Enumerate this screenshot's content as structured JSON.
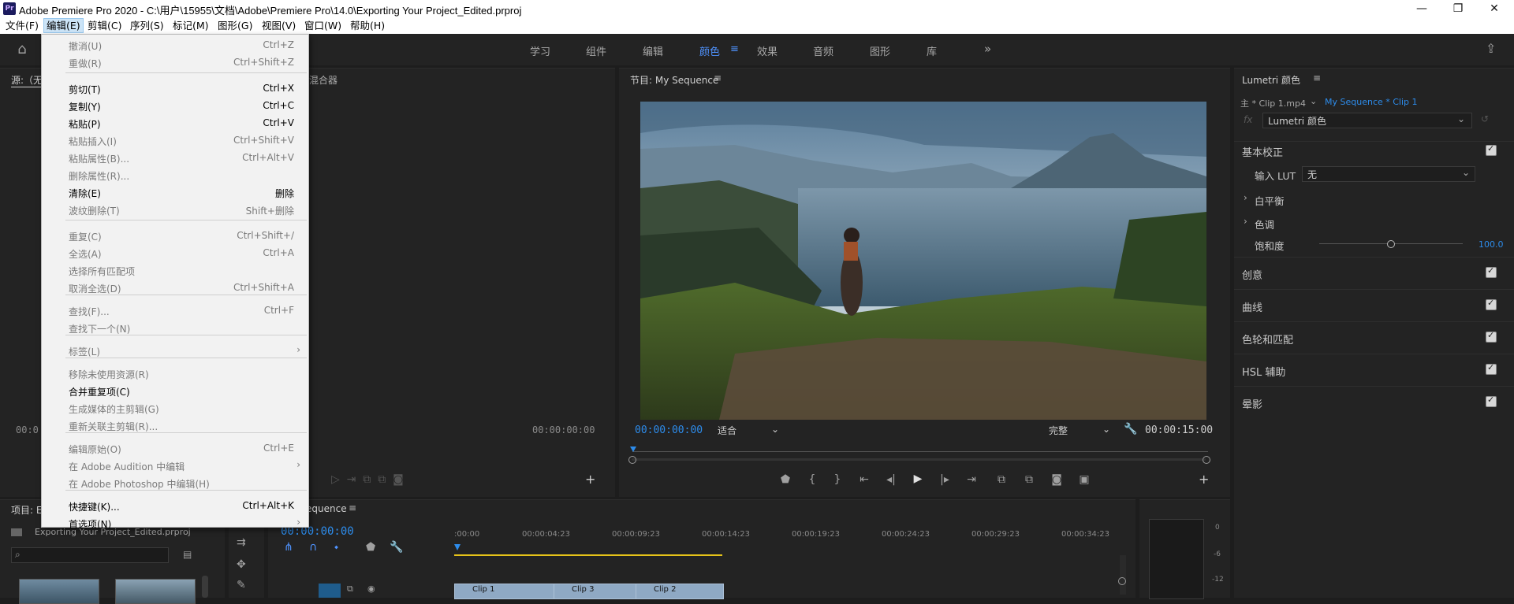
{
  "window": {
    "title": "Adobe Premiere Pro 2020 - C:\\用户\\15955\\文档\\Adobe\\Premiere Pro\\14.0\\Exporting Your Project_Edited.prproj",
    "logo": "Pr",
    "controls": [
      "—",
      "❐",
      "✕"
    ]
  },
  "menubar": [
    "文件(F)",
    "编辑(E)",
    "剪辑(C)",
    "序列(S)",
    "标记(M)",
    "图形(G)",
    "视图(V)",
    "窗口(W)",
    "帮助(H)"
  ],
  "workspaces": [
    "学习",
    "组件",
    "编辑",
    "颜色",
    "效果",
    "音频",
    "图形",
    "库"
  ],
  "workspace_active": "颜色",
  "edit_menu": [
    {
      "label": "撤消(U)",
      "shortcut": "Ctrl+Z",
      "enabled": false
    },
    {
      "label": "重做(R)",
      "shortcut": "Ctrl+Shift+Z",
      "enabled": false
    },
    {
      "label": "剪切(T)",
      "shortcut": "Ctrl+X",
      "enabled": true
    },
    {
      "label": "复制(Y)",
      "shortcut": "Ctrl+C",
      "enabled": true
    },
    {
      "label": "粘贴(P)",
      "shortcut": "Ctrl+V",
      "enabled": true
    },
    {
      "label": "粘贴插入(I)",
      "shortcut": "Ctrl+Shift+V",
      "enabled": false
    },
    {
      "label": "粘贴属性(B)...",
      "shortcut": "Ctrl+Alt+V",
      "enabled": false
    },
    {
      "label": "删除属性(R)...",
      "shortcut": "",
      "enabled": false
    },
    {
      "label": "清除(E)",
      "shortcut": "删除",
      "enabled": true
    },
    {
      "label": "波纹删除(T)",
      "shortcut": "Shift+删除",
      "enabled": false
    },
    {
      "label": "重复(C)",
      "shortcut": "Ctrl+Shift+/",
      "enabled": false
    },
    {
      "label": "全选(A)",
      "shortcut": "Ctrl+A",
      "enabled": false
    },
    {
      "label": "选择所有匹配项",
      "shortcut": "",
      "enabled": false
    },
    {
      "label": "取消全选(D)",
      "shortcut": "Ctrl+Shift+A",
      "enabled": false
    },
    {
      "label": "查找(F)...",
      "shortcut": "Ctrl+F",
      "enabled": false
    },
    {
      "label": "查找下一个(N)",
      "shortcut": "",
      "enabled": false
    },
    {
      "label": "标签(L)",
      "shortcut": "",
      "enabled": false,
      "submenu": true
    },
    {
      "label": "移除未使用资源(R)",
      "shortcut": "",
      "enabled": false
    },
    {
      "label": "合并重复项(C)",
      "shortcut": "",
      "enabled": true
    },
    {
      "label": "生成媒体的主剪辑(G)",
      "shortcut": "",
      "enabled": false
    },
    {
      "label": "重新关联主剪辑(R)...",
      "shortcut": "",
      "enabled": false
    },
    {
      "label": "编辑原始(O)",
      "shortcut": "Ctrl+E",
      "enabled": false
    },
    {
      "label": "在 Adobe Audition 中编辑",
      "shortcut": "",
      "enabled": false,
      "submenu": true
    },
    {
      "label": "在 Adobe Photoshop 中编辑(H)",
      "shortcut": "",
      "enabled": false
    },
    {
      "label": "快捷键(K)...",
      "shortcut": "Ctrl+Alt+K",
      "enabled": true
    },
    {
      "label": "首选项(N)",
      "shortcut": "",
      "enabled": true,
      "submenu": true
    }
  ],
  "source_panel": {
    "tab": "源:（无",
    "mixer_tab": "混合器",
    "timecode_left": "00:0",
    "timecode_right": "00:00:00:00"
  },
  "program": {
    "title": "节目: My Sequence",
    "timecode": "00:00:00:00",
    "fit": "适合",
    "quality": "完整",
    "duration": "00:00:15:00"
  },
  "lumetri": {
    "title": "Lumetri 颜色",
    "clip_master": "主 * Clip 1.mp4",
    "clip_seq": "My Sequence * Clip 1",
    "effect": "Lumetri 颜色",
    "basic": "基本校正",
    "input_lut_label": "输入 LUT",
    "input_lut_value": "无",
    "white_balance": "白平衡",
    "tone": "色调",
    "saturation_label": "饱和度",
    "saturation_value": "100.0",
    "saturation_level": 0.5,
    "sections": [
      "创意",
      "曲线",
      "色轮和匹配",
      "HSL 辅助",
      "晕影"
    ]
  },
  "project": {
    "tab": "项目: E",
    "file": "Exporting Your Project_Edited.prproj"
  },
  "timeline": {
    "tab": "equence",
    "timecode": "00:00:00:00",
    "ruler": [
      ":00:00",
      "00:00:04:23",
      "00:00:09:23",
      "00:00:14:23",
      "00:00:19:23",
      "00:00:24:23",
      "00:00:29:23",
      "00:00:34:23"
    ],
    "clips": [
      "Clip 1",
      "Clip 3",
      "Clip 2"
    ]
  },
  "meter": {
    "labels": [
      "0",
      "-6",
      "-12"
    ]
  }
}
